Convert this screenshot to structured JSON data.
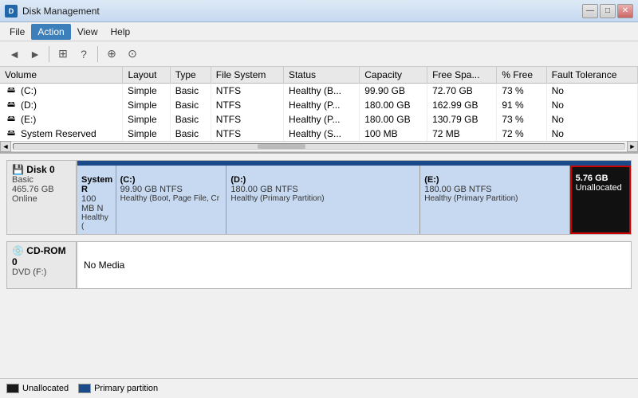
{
  "window": {
    "title": "Disk Management",
    "controls": [
      "—",
      "□",
      "✕"
    ]
  },
  "menu": {
    "items": [
      "File",
      "Action",
      "View",
      "Help"
    ]
  },
  "toolbar": {
    "buttons": [
      "◄",
      "►",
      "⊞",
      "?",
      "⊟",
      "⊞",
      "⊕",
      "⊙"
    ]
  },
  "table": {
    "headers": [
      "Volume",
      "Layout",
      "Type",
      "File System",
      "Status",
      "Capacity",
      "Free Spa...",
      "% Free",
      "Fault Tolerance"
    ],
    "rows": [
      {
        "volume": "(C:)",
        "layout": "Simple",
        "type": "Basic",
        "fs": "NTFS",
        "status": "Healthy (B...",
        "capacity": "99.90 GB",
        "free": "72.70 GB",
        "pct": "73 %",
        "fault": "No"
      },
      {
        "volume": "(D:)",
        "layout": "Simple",
        "type": "Basic",
        "fs": "NTFS",
        "status": "Healthy (P...",
        "capacity": "180.00 GB",
        "free": "162.99 GB",
        "pct": "91 %",
        "fault": "No"
      },
      {
        "volume": "(E:)",
        "layout": "Simple",
        "type": "Basic",
        "fs": "NTFS",
        "status": "Healthy (P...",
        "capacity": "180.00 GB",
        "free": "130.79 GB",
        "pct": "73 %",
        "fault": "No"
      },
      {
        "volume": "System Reserved",
        "layout": "Simple",
        "type": "Basic",
        "fs": "NTFS",
        "status": "Healthy (S...",
        "capacity": "100 MB",
        "free": "72 MB",
        "pct": "72 %",
        "fault": "No"
      }
    ]
  },
  "disk0": {
    "label": "Disk 0",
    "type": "Basic",
    "size": "465.76 GB",
    "status": "Online",
    "partitions": [
      {
        "name": "System R",
        "size": "100 MB N",
        "status": "Healthy (",
        "width": 7,
        "type": "primary"
      },
      {
        "name": "(C:)",
        "size": "99.90 GB NTFS",
        "status": "Healthy (Boot, Page File, Cr",
        "width": 20,
        "type": "primary"
      },
      {
        "name": "(D:)",
        "size": "180.00 GB NTFS",
        "status": "Healthy (Primary Partition)",
        "width": 36,
        "type": "primary"
      },
      {
        "name": "(E:)",
        "size": "180.00 GB NTFS",
        "status": "Healthy (Primary Partition)",
        "width": 36,
        "type": "primary"
      },
      {
        "name": "5.76 GB",
        "size": "Unallocated",
        "status": "",
        "width": 11,
        "type": "unallocated"
      }
    ]
  },
  "cdrom0": {
    "label": "CD-ROM 0",
    "type": "DVD (F:)",
    "status": "No Media"
  },
  "legend": {
    "items": [
      {
        "type": "unallocated",
        "label": "Unallocated"
      },
      {
        "type": "primary",
        "label": "Primary partition"
      }
    ]
  }
}
